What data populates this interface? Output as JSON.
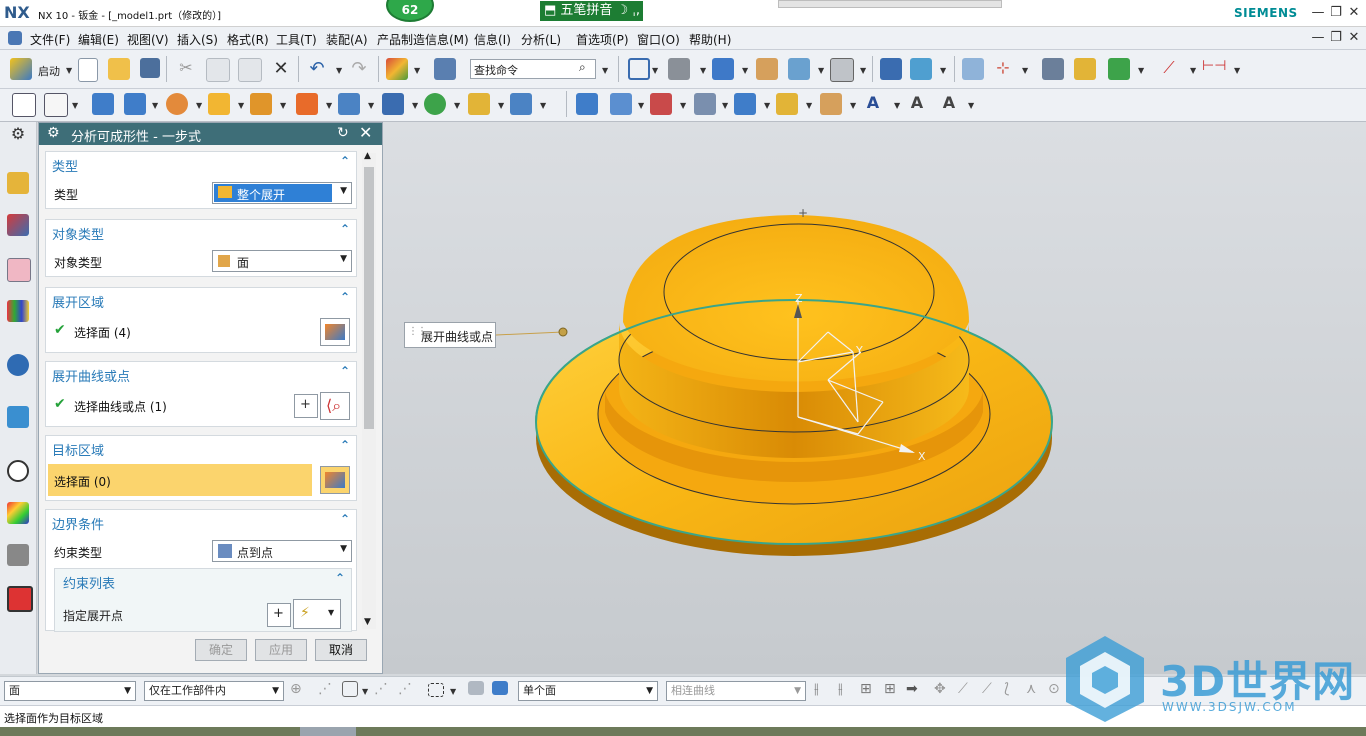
{
  "window": {
    "app_logo": "NX",
    "title": "NX 10 - 钣金 - [_model1.prt（修改的）]",
    "badge": "62",
    "ime": "五笔拼音",
    "brand": "SIEMENS"
  },
  "menu": {
    "items": [
      "文件(F)",
      "编辑(E)",
      "视图(V)",
      "插入(S)",
      "格式(R)",
      "工具(T)",
      "装配(A)",
      "产品制造信息(M)",
      "信息(I)",
      "分析(L)",
      "首选项(P)",
      "窗口(O)",
      "帮助(H)"
    ]
  },
  "toolbar": {
    "start_label": "启动",
    "search_placeholder": "查找命令"
  },
  "dialog": {
    "title": "分析可成形性 - 一步式",
    "type_section": {
      "header": "类型",
      "label": "类型",
      "value": "整个展开"
    },
    "object_section": {
      "header": "对象类型",
      "label": "对象类型",
      "value": "面"
    },
    "unfold_region": {
      "header": "展开区域",
      "select_label": "选择面 (4)"
    },
    "unfold_curve": {
      "header": "展开曲线或点",
      "select_label": "选择曲线或点 (1)"
    },
    "target_region": {
      "header": "目标区域",
      "select_label": "选择面 (0)"
    },
    "boundary": {
      "header": "边界条件",
      "constraint_type_label": "约束类型",
      "constraint_type_value": "点到点",
      "constraint_list_header": "约束列表",
      "specify_point_label": "指定展开点"
    },
    "buttons": {
      "ok": "确定",
      "apply": "应用",
      "cancel": "取消"
    }
  },
  "viewport": {
    "callout": "展开曲线或点",
    "axis_x": "X",
    "axis_y": "Y",
    "axis_z": "Z"
  },
  "selection_bar": {
    "filter": "面",
    "scope": "仅在工作部件内",
    "face_rule": "单个面",
    "curve_rule": "相连曲线"
  },
  "status": {
    "text": "选择面作为目标区域"
  },
  "watermark": {
    "text": "3D世界网",
    "url": "WWW.3DSJW.COM"
  },
  "colors": {
    "dialog_header": "#3e6e78",
    "section_header": "#2a7bb8",
    "highlight_row": "#fbd46d",
    "part_orange": "#f7b21a"
  }
}
